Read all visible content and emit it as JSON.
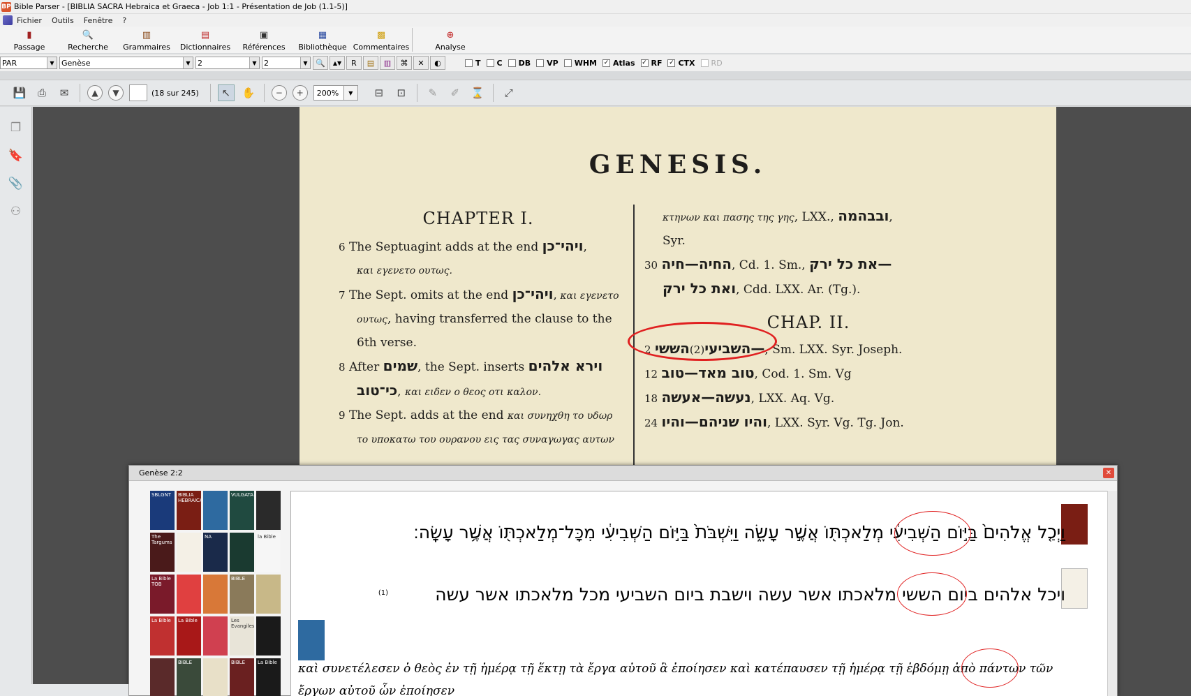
{
  "window": {
    "title": "Bible Parser - [BIBLIA SACRA Hebraica et Graeca - Job 1:1 - Présentation de Job (1.1-5)]",
    "app_icon": "BP"
  },
  "menu": [
    "Fichier",
    "Outils",
    "Fenêtre",
    "?"
  ],
  "main_toolbar": [
    {
      "label": "Passage",
      "icon": "book-icon"
    },
    {
      "label": "Recherche",
      "icon": "search-icon"
    },
    {
      "label": "Grammaires",
      "icon": "books-icon"
    },
    {
      "label": "Dictionnaires",
      "icon": "dictionary-icon"
    },
    {
      "label": "Références",
      "icon": "references-icon"
    },
    {
      "label": "Bibliothèque",
      "icon": "library-icon"
    },
    {
      "label": "Commentaires",
      "icon": "commentary-icon"
    },
    {
      "label": "Analyse",
      "icon": "analyse-icon"
    }
  ],
  "selectors": {
    "version": "PAR",
    "book": "Genèse",
    "chapter": "2",
    "verse": "2",
    "r_label": "R"
  },
  "checkboxes": [
    {
      "label": "T",
      "checked": false,
      "enabled": true
    },
    {
      "label": "C",
      "checked": false,
      "enabled": true
    },
    {
      "label": "DB",
      "checked": false,
      "enabled": true
    },
    {
      "label": "VP",
      "checked": false,
      "enabled": true
    },
    {
      "label": "WHM",
      "checked": false,
      "enabled": true
    },
    {
      "label": "Atlas",
      "checked": true,
      "enabled": true
    },
    {
      "label": "RF",
      "checked": true,
      "enabled": true
    },
    {
      "label": "CTX",
      "checked": true,
      "enabled": true
    },
    {
      "label": "RD",
      "checked": false,
      "enabled": false
    }
  ],
  "pdf_toolbar": {
    "page_count": "(18 sur 245)",
    "zoom": "200%"
  },
  "document": {
    "title": "GENESIS.",
    "left": {
      "chapter": "CHAPTER I.",
      "lines": [
        {
          "num": "6",
          "text": " The Septuagint adds at the end ",
          "he": "ויהי־כן",
          "tail": ","
        },
        {
          "gr": "και εγενετο ουτως."
        },
        {
          "num": "7",
          "text": " The Sept. omits at the end ",
          "he": "ויהי־כן",
          "tail": ",",
          "gr2": " και εγενετο"
        },
        {
          "gr": "ουτως",
          "text": ", having transferred the clause to the"
        },
        {
          "text": "6th verse."
        },
        {
          "num": "8",
          "text": " After ",
          "he": "שמים",
          "tail": ", the Sept. inserts ",
          "he2": "וירא אלהים"
        },
        {
          "he": "כי־טוב",
          "tail": ", ",
          "gr": "και ειδεν ο θεος οτι καλον."
        },
        {
          "num": "9",
          "text": " The Sept. adds at the end ",
          "gr2": "και συνηχθη το υδωρ"
        },
        {
          "gr": "το υποκατω του ουρανου εις τας συναγωγας αυτων"
        }
      ]
    },
    "right": {
      "lines_top": [
        {
          "gr": "κτηνων και πασης της γης",
          "text": ", LXX., ",
          "he": "ובבהמה",
          "tail": ","
        },
        {
          "text": "Syr."
        },
        {
          "num": "30",
          "text": " ",
          "he": "החיה—חיה",
          "tail": ", Cd. 1. Sm., ",
          "he2": "את כל ירק—"
        },
        {
          "he": "ואת כל ירק",
          "tail": ", Cdd. LXX. Ar. (Tg.)."
        }
      ],
      "chapter": "CHAP. II.",
      "lines_bottom": [
        {
          "num": "2",
          "he": "הששי—",
          "mid": "(2)",
          "he2": "השביעי",
          "tail": ", Sm. LXX. Syr. Joseph."
        },
        {
          "num": "12",
          "he": "טוב מאד—טוב",
          "tail": ", Cod. 1. Sm. Vg"
        },
        {
          "num": "18",
          "he": "נעשה—אעשה",
          "tail": ", LXX. Aq. Vg."
        },
        {
          "num": "24",
          "he": "והיו שניהם—והיו",
          "tail": ", LXX. Syr. Vg. Tg. Jon."
        }
      ]
    }
  },
  "popup": {
    "title": "Genèse 2:2",
    "hebrew_masoretic": "וַיְכַ֤ל אֱלֹהִים֙ בַּיּ֣וֹם הַשְּׁבִיעִ֔י מְלַאכְתּ֖וֹ אֲשֶׁ֣ר עָשָׂ֑ה וַיִּשְׁבֹּת֙ בַּיּ֣וֹם הַשְּׁבִיעִ֔י מִכָּל־מְלַאכְתּ֖וֹ אֲשֶׁ֥ר עָשָֽׂה׃",
    "hebrew_samaritan": "ויכל אלהים ביום הששי מלאכתו אשר עשה וישבת ביום השביעי מכל מלאכתו אשר עשה",
    "verse_marker": "(1)",
    "greek": "καὶ συνετέλεσεν ὁ θεὸς ἐν τῇ ἡμέρᾳ τῇ ἕκτῃ τὰ ἔργα αὐτοῦ ἃ ἐποίησεν καὶ κατέπαυσεν τῇ ἡμέρᾳ τῇ ἑβδόμῃ ἀπὸ πάντων τῶν ἔργων αὐτοῦ ὧν ἐποίησεν",
    "thumbnails": [
      {
        "label": "SBLGNT",
        "color": "#1a3a7a"
      },
      {
        "label": "BIBLIA HEBRAICA",
        "color": "#7a1e14"
      },
      {
        "label": "",
        "color": "#2e6aa0"
      },
      {
        "label": "VULGATA",
        "color": "#204a40"
      },
      {
        "label": "",
        "color": "#2a2a2a"
      },
      {
        "label": "The Targums",
        "color": "#4a1a1a"
      },
      {
        "label": "",
        "color": "#f4f0e6"
      },
      {
        "label": "NA",
        "color": "#1a2a4a"
      },
      {
        "label": "",
        "color": "#1a3a30"
      },
      {
        "label": "la Bible",
        "color": "#f6f6f6"
      },
      {
        "label": "La Bible TOB",
        "color": "#7a1a2a"
      },
      {
        "label": "",
        "color": "#e04040"
      },
      {
        "label": "",
        "color": "#d87838"
      },
      {
        "label": "BIBLE",
        "color": "#8a7a5a"
      },
      {
        "label": "",
        "color": "#c8b888"
      },
      {
        "label": "La Bible",
        "color": "#c03030"
      },
      {
        "label": "La Bible",
        "color": "#a81818"
      },
      {
        "label": "",
        "color": "#d04050"
      },
      {
        "label": "Les Evangiles",
        "color": "#e8e4d8"
      },
      {
        "label": "",
        "color": "#1a1a1a"
      },
      {
        "label": "",
        "color": "#5a2a2a"
      },
      {
        "label": "BIBLE",
        "color": "#3a4a3a"
      },
      {
        "label": "",
        "color": "#e8e0c8"
      },
      {
        "label": "BIBLE",
        "color": "#6a2020"
      },
      {
        "label": "La Bible",
        "color": "#1a1a1a"
      }
    ]
  }
}
